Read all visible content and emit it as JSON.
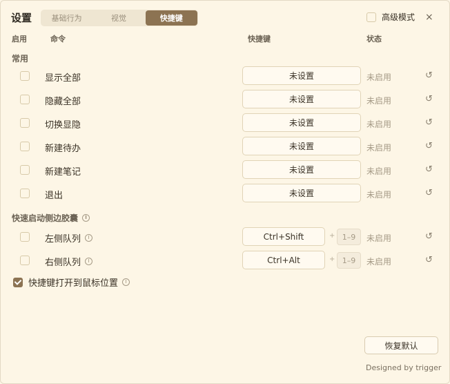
{
  "header": {
    "title": "设置",
    "tabs": [
      {
        "label": "基础行为"
      },
      {
        "label": "视觉"
      },
      {
        "label": "快捷键"
      }
    ],
    "advanced_mode_label": "高级模式",
    "close_label": "×"
  },
  "columns": {
    "enable": "启用",
    "command": "命令",
    "shortcut": "快捷键",
    "status": "状态"
  },
  "sections": {
    "common": "常用",
    "sidebar": "快速启动侧边胶囊"
  },
  "rows": [
    {
      "command": "显示全部",
      "shortcut": "未设置",
      "status": "未启用"
    },
    {
      "command": "隐藏全部",
      "shortcut": "未设置",
      "status": "未启用"
    },
    {
      "command": "切换显隐",
      "shortcut": "未设置",
      "status": "未启用"
    },
    {
      "command": "新建待办",
      "shortcut": "未设置",
      "status": "未启用"
    },
    {
      "command": "新建笔记",
      "shortcut": "未设置",
      "status": "未启用"
    },
    {
      "command": "退出",
      "shortcut": "未设置",
      "status": "未启用"
    }
  ],
  "sidebar_rows": [
    {
      "command": "左侧队列",
      "shortcut": "Ctrl+Shift",
      "plus": "+",
      "range": "1–9",
      "status": "未启用"
    },
    {
      "command": "右侧队列",
      "shortcut": "Ctrl+Alt",
      "plus": "+",
      "range": "1–9",
      "status": "未启用"
    }
  ],
  "options": {
    "open_at_mouse_label": "快捷键打开到鼠标位置",
    "open_at_mouse_checked": true
  },
  "icons": {
    "reset": "↺",
    "info": "i"
  },
  "footer": {
    "restore_label": "恢复默认",
    "credit": "Designed by trigger"
  },
  "colors": {
    "background": "#fdf6e6",
    "accent": "#8c7352"
  }
}
